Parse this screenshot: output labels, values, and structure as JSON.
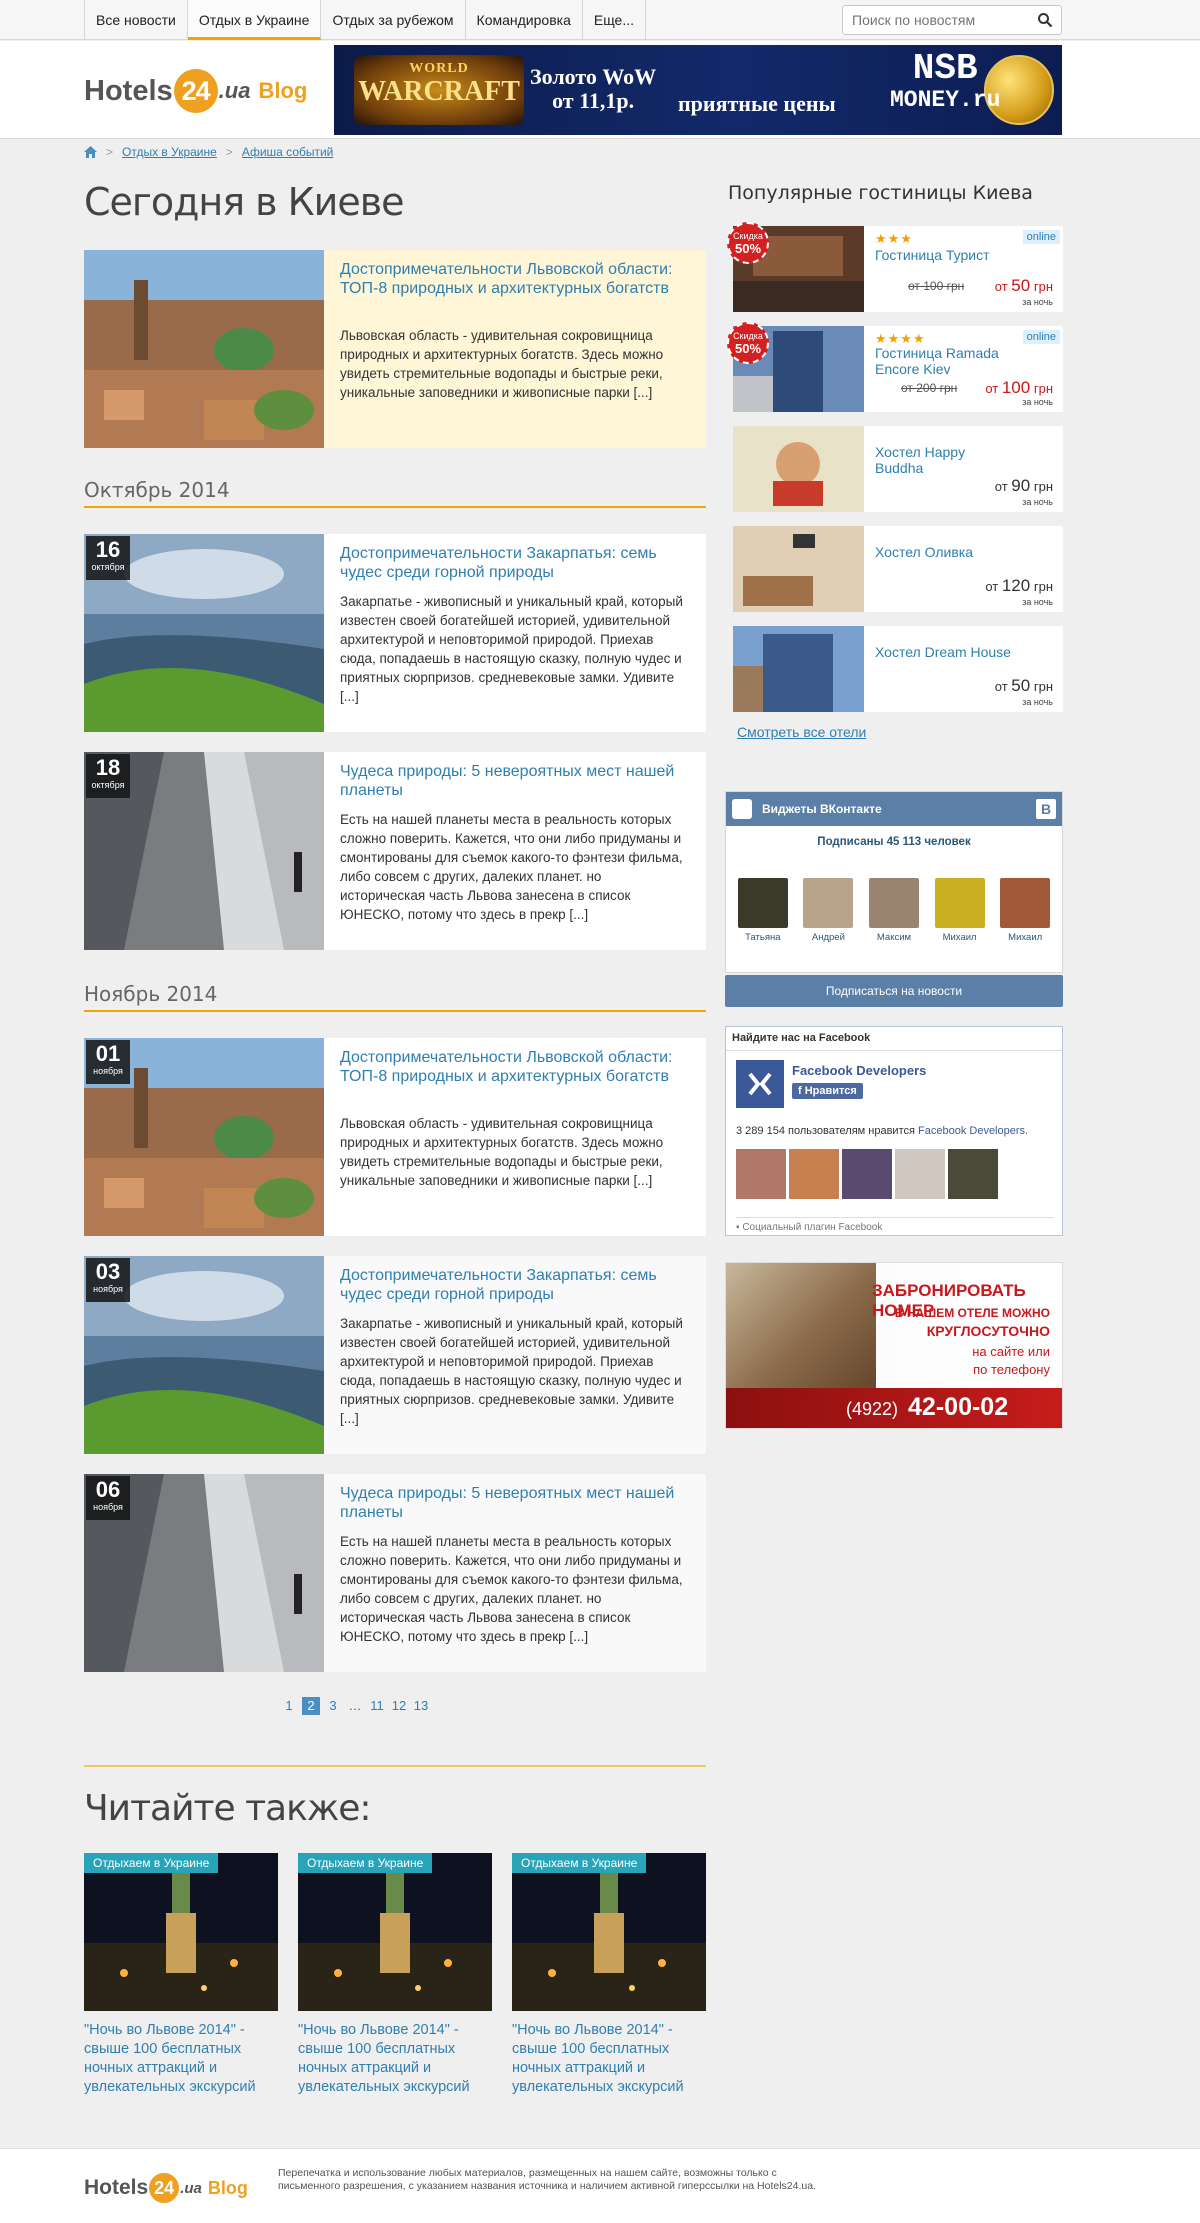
{
  "nav": {
    "tabs": [
      {
        "label": "Все новости"
      },
      {
        "label": "Отдых в Украине"
      },
      {
        "label": "Отдых за рубежом"
      },
      {
        "label": "Командировка"
      },
      {
        "label": "Еще..."
      }
    ],
    "active_tab": 1,
    "search_placeholder": "Поиск по новостям"
  },
  "header": {
    "logo_hotels": "Hotels",
    "logo_24": "24",
    "logo_ua": ".ua",
    "logo_blog": "Blog",
    "banner": {
      "wow_top": "WORLD",
      "wow_main": "WARCRAFT",
      "line1": "Золото WoW",
      "line2": "от 11,1р.",
      "line3": "приятные цены",
      "nsb": "NSB",
      "money": "MONEY.ru"
    }
  },
  "breadcrumb": {
    "items": [
      "Отдых в Украине",
      "Афиша событий"
    ]
  },
  "main": {
    "title": "Сегодня в Киеве",
    "featured": {
      "title": "Достопримечательности Львовской области: ТОП-8 природных и архитектурных богатств",
      "text": "Львовская область - удивительная сокровищница природных и архитектурных богатств. Здесь можно увидеть стремительные водопады и быстрые реки, уникальные заповедники и живописные парки [...]"
    },
    "sections": [
      {
        "heading": "Октябрь 2014",
        "articles": [
          {
            "day": "16",
            "month": "октября",
            "title": "Достопримечательности Закарпатья: семь чудес среди горной природы",
            "text": "Закарпатье - живописный и уникальный край, который известен своей богатейшей историей, удивительной архитектурой и неповторимой природой. Приехав сюда, попадаешь в настоящую сказку, полную чудес и приятных сюрпризов. средневековые замки. Удивите [...]"
          },
          {
            "day": "18",
            "month": "октября",
            "title": "Чудеса природы: 5 невероятных мест нашей планеты",
            "text": "Есть на нашей планеты места в реальность которых сложно поверить. Кажется, что они либо придуманы и смонтированы для съемок какого-то фэнтези фильма, либо совсем с других, далеких планет. но историческая часть Львова занесена в список ЮНЕСКО, потому что здесь в прекр [...]"
          }
        ]
      },
      {
        "heading": "Ноябрь 2014",
        "articles": [
          {
            "day": "01",
            "month": "ноября",
            "title": "Достопримечательности Львовской области: ТОП-8 природных и архитектурных богатств",
            "text": "Львовская область - удивительная сокровищница природных и архитектурных богатств. Здесь можно увидеть стремительные водопады и быстрые реки, уникальные заповедники и живописные парки [...]"
          },
          {
            "day": "03",
            "month": "ноября",
            "title": "Достопримечательности Закарпатья: семь чудес среди горной природы",
            "text": "Закарпатье - живописный и уникальный край, который известен своей богатейшей историей, удивительной архитектурой и неповторимой природой. Приехав сюда, попадаешь в настоящую сказку, полную чудес и приятных сюрпризов. средневековые замки. Удивите [...]"
          },
          {
            "day": "06",
            "month": "ноября",
            "title": "Чудеса природы: 5 невероятных мест нашей планеты",
            "text": "Есть на нашей планеты места в реальность которых сложно поверить. Кажется, что они либо придуманы и смонтированы для съемок какого-то фэнтези фильма, либо совсем с других, далеких планет. но историческая часть Львова занесена в список ЮНЕСКО, потому что здесь в прекр [...]"
          }
        ]
      }
    ],
    "pagination": [
      "1",
      "2",
      "3",
      "…",
      "11",
      "12",
      "13"
    ],
    "current_page": "2",
    "also_title": "Читайте также:",
    "also": [
      {
        "tag": "Отдыхаем в Украине",
        "title": "\"Ночь во Львове 2014\" - свыше 100 бесплатных ночных аттракций и увлекательных экскурсий"
      },
      {
        "tag": "Отдыхаем в Украине",
        "title": "\"Ночь во Львове 2014\" - свыше 100 бесплатных ночных аттракций и увлекательных экскурсий"
      },
      {
        "tag": "Отдыхаем в Украине",
        "title": "\"Ночь во Львове 2014\" - свыше 100 бесплатных ночных аттракций и увлекательных экскурсий"
      }
    ]
  },
  "sidebar": {
    "title": "Популярные гостиницы Киева",
    "hotels": [
      {
        "name": "Гостиница Турист",
        "stars": "★★★",
        "online": "online",
        "sale_label": "Скидка",
        "sale_value": "50%",
        "old_price": "от 100 грн",
        "price_prefix": "от",
        "price": "50",
        "currency": "грн",
        "per": "за ночь"
      },
      {
        "name": "Гостиница Ramada Encore Kiev",
        "stars": "★★★★",
        "online": "online",
        "sale_label": "Скидка",
        "sale_value": "50%",
        "old_price": "от 200 грн",
        "price_prefix": "от",
        "price": "100",
        "currency": "грн",
        "per": "за ночь"
      },
      {
        "name": "Хостел Happy Buddha",
        "price_prefix": "от",
        "price": "90",
        "currency": "грн",
        "per": "за ночь"
      },
      {
        "name": "Хостел Оливка",
        "price_prefix": "от",
        "price": "120",
        "currency": "грн",
        "per": "за ночь"
      },
      {
        "name": "Хостел Dream House",
        "price_prefix": "от",
        "price": "50",
        "currency": "грн",
        "per": "за ночь"
      }
    ],
    "all_hotels": "Смотреть все отели",
    "vk": {
      "title": "Виджеты ВКонтакте",
      "subscribers": "Подписаны 45 113 человек",
      "people": [
        "Татьяна",
        "Андрей",
        "Максим",
        "Михаил",
        "Михаил"
      ],
      "subscribe": "Подписаться на новости"
    },
    "fb": {
      "title": "Найдите нас на Facebook",
      "page": "Facebook Developers",
      "like": "Нравится",
      "count_text": "3 289 154 пользователям нравится",
      "count_page": "Facebook Developers.",
      "plugin": "Социальный плагин Facebook"
    },
    "ad": {
      "line1": "ЗАБРОНИРОВАТЬ НОМЕР",
      "line2": "В НАШЕМ ОТЕЛЕ МОЖНО",
      "line3": "КРУГЛОСУТОЧНО",
      "line4": "на сайте или",
      "line5": "по телефону",
      "code": "(4922)",
      "phone": "42-00-02"
    }
  },
  "footer": {
    "text": "Перепечатка и использование любых материалов, размещенных на нашем сайте, возможны только с письменного разрешения, с указанием названия источника и наличием активной гиперссылки на Hotels24.ua."
  },
  "colors": {
    "accent": "#f0a500",
    "link": "#2f7fb0",
    "featured_bg": "#fef6d7",
    "vk": "#5b7fa6",
    "sale": "#d42020",
    "price_red": "#c81818"
  }
}
